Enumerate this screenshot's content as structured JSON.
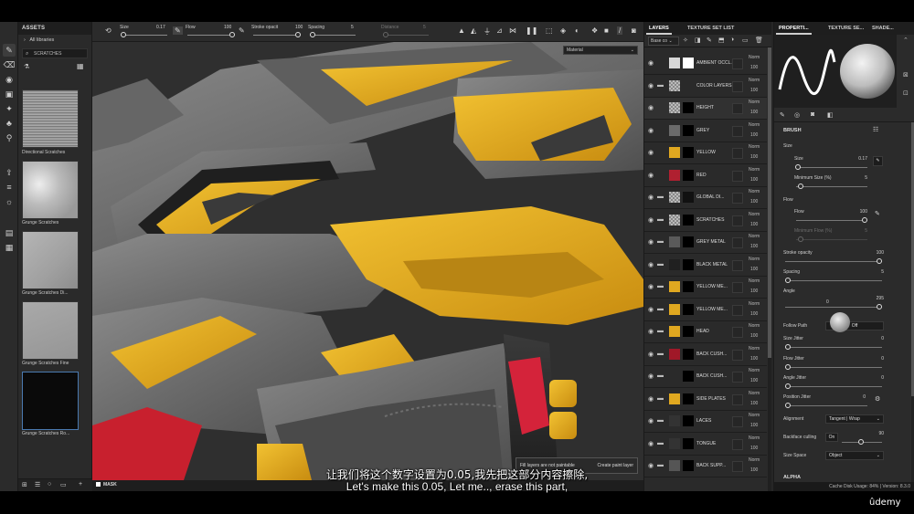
{
  "assets": {
    "title": "ASSETS",
    "all_libraries": "All libraries",
    "search_value": "SCRATCHES",
    "items": [
      {
        "label": "Directional Scratches"
      },
      {
        "label": "Grunge Scratches"
      },
      {
        "label": "Grunge Scratches Di..."
      },
      {
        "label": "Grunge Scratches Fine"
      },
      {
        "label": "Grunge Scratches Ro..."
      }
    ]
  },
  "toolbar": {
    "size_label": "Size",
    "size_value": "0.17",
    "flow_label": "Flow",
    "flow_value": "100",
    "stroke_label": "Stroke opacit",
    "stroke_value": "100",
    "spacing_label": "Spacing",
    "spacing_value": "5",
    "distance_label": "Distance",
    "distance_value": "5"
  },
  "viewport": {
    "material_select": "Material",
    "mask_label": "MASK",
    "toast_text": "Fill layers are not paintable",
    "toast_button": "Create paint layer"
  },
  "layers": {
    "tab_layers": "LAYERS",
    "tab_texture_set": "TEXTURE SET LIST",
    "channel_select": "Base co",
    "rows": [
      {
        "name": "AMBIENT OCCL...",
        "mode": "Norm",
        "opacity": "100",
        "folder": false,
        "t1": "#d8d8d8",
        "t2": "#ffffff"
      },
      {
        "name": "COLOR LAYERS",
        "mode": "Norm",
        "opacity": "100",
        "folder": true,
        "t1": "checker",
        "t2": ""
      },
      {
        "name": "HEIGHT",
        "mode": "Norm",
        "opacity": "100",
        "folder": false,
        "t1": "checker",
        "t2": "#000000"
      },
      {
        "name": "GREY",
        "mode": "Norm",
        "opacity": "100",
        "folder": false,
        "t1": "#6a6a6a",
        "t2": "#000000"
      },
      {
        "name": "YELLOW",
        "mode": "Norm",
        "opacity": "100",
        "folder": false,
        "t1": "#e0a820",
        "t2": "#000000"
      },
      {
        "name": "RED",
        "mode": "Norm",
        "opacity": "100",
        "folder": false,
        "t1": "#b02030",
        "t2": "#000000"
      },
      {
        "name": "GLOBAL DI...",
        "mode": "Norm",
        "opacity": "100",
        "folder": true,
        "t1": "checker",
        "t2": "#111111"
      },
      {
        "name": "SCRATCHES",
        "mode": "Norm",
        "opacity": "100",
        "folder": true,
        "t1": "checker",
        "t2": "#000000"
      },
      {
        "name": "GREY METAL",
        "mode": "Norm",
        "opacity": "100",
        "folder": true,
        "t1": "#5a5a5a",
        "t2": "#000000"
      },
      {
        "name": "BLACK METAL",
        "mode": "Norm",
        "opacity": "100",
        "folder": true,
        "t1": "#202020",
        "t2": "#000000"
      },
      {
        "name": "YELLOW ME...",
        "mode": "Norm",
        "opacity": "100",
        "folder": true,
        "t1": "#e0a820",
        "t2": "#000000"
      },
      {
        "name": "YELLOW ME...",
        "mode": "Norm",
        "opacity": "100",
        "folder": true,
        "t1": "#e0a820",
        "t2": "#000000"
      },
      {
        "name": "HEAD",
        "mode": "Norm",
        "opacity": "100",
        "folder": true,
        "t1": "#e0a820",
        "t2": "#000000"
      },
      {
        "name": "BACK CUSH...",
        "mode": "Norm",
        "opacity": "100",
        "folder": true,
        "t1": "#a01828",
        "t2": "#000000"
      },
      {
        "name": "BACK CUSH...",
        "mode": "Norm",
        "opacity": "100",
        "folder": true,
        "t1": "#2a2a2a",
        "t2": "#000000"
      },
      {
        "name": "SIDE PLATES",
        "mode": "Norm",
        "opacity": "100",
        "folder": true,
        "t1": "#e0a820",
        "t2": "#000000"
      },
      {
        "name": "LACES",
        "mode": "Norm",
        "opacity": "100",
        "folder": true,
        "t1": "#333333",
        "t2": "#000000"
      },
      {
        "name": "TONGUE",
        "mode": "Norm",
        "opacity": "100",
        "folder": true,
        "t1": "#333333",
        "t2": "#000000"
      },
      {
        "name": "BACK SUPP...",
        "mode": "Norm",
        "opacity": "100",
        "folder": true,
        "t1": "#555555",
        "t2": "#000000"
      }
    ]
  },
  "properties": {
    "tab_properties": "PROPERTI...",
    "tab_texture_set": "TEXTURE SE...",
    "tab_shader": "SHADE...",
    "brush_title": "BRUSH",
    "size_section": "Size",
    "size_label": "Size",
    "size_value": "0.17",
    "min_size_label": "Minimum Size (%)",
    "min_size_value": "5",
    "flow_section": "Flow",
    "flow_label": "Flow",
    "flow_value": "100",
    "min_flow_label": "Minimum Flow (%)",
    "min_flow_value": "5",
    "stroke_label": "Stroke opacity",
    "stroke_value": "100",
    "spacing_label": "Spacing",
    "spacing_value": "5",
    "angle_label": "Angle",
    "angle_value": "295",
    "angle_zero": "0",
    "follow_path_label": "Follow Path",
    "follow_path_value": "Off",
    "size_jitter_label": "Size Jitter",
    "size_jitter_value": "0",
    "flow_jitter_label": "Flow Jitter",
    "flow_jitter_value": "0",
    "angle_jitter_label": "Angle Jitter",
    "angle_jitter_value": "0",
    "position_jitter_label": "Position Jitter",
    "position_jitter_value": "0",
    "alignment_label": "Alignment",
    "alignment_value": "Tangent | Wrap",
    "backface_label": "Backface culling",
    "backface_toggle": "On",
    "backface_value": "90",
    "size_space_label": "Size Space",
    "size_space_value": "Object",
    "alpha_title": "ALPHA"
  },
  "status": {
    "text": "Cache Disk Usage:  84%  |  Version: 8.3.0"
  },
  "subtitles": {
    "chinese": "让我们将这个数字设置为0.05,我先把这部分内容擦除,",
    "english": "Let's make this 0.05, Let me.., erase this part,",
    "watermark": "ûdemy"
  },
  "colors": {
    "panel": "#2a2a2a",
    "yellow_paint": "#e3b020",
    "metal_grey": "#6e6e6e",
    "red_cushion": "#c8202e"
  }
}
